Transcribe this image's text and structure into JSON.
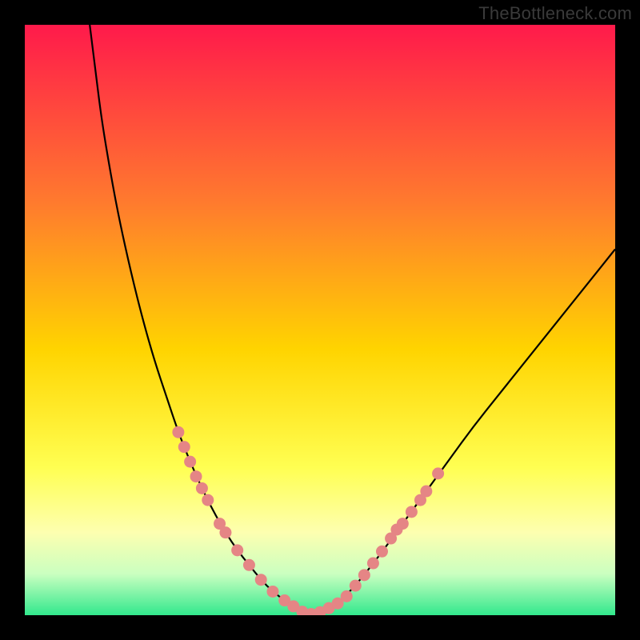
{
  "watermark": "TheBottleneck.com",
  "colors": {
    "grad_top": "#ff1a4b",
    "grad_mid1": "#ff7a2e",
    "grad_mid2": "#ffd400",
    "grad_mid3": "#ffff52",
    "grad_mid4": "#fdffb0",
    "grad_bottom1": "#caffc0",
    "grad_bottom2": "#32e88d",
    "curve": "#000000",
    "dots": "#e58585",
    "frame": "#000000"
  },
  "chart_data": {
    "type": "line",
    "title": "",
    "xlabel": "",
    "ylabel": "",
    "xlim": [
      0,
      100
    ],
    "ylim": [
      0,
      100
    ],
    "background_gradient_stops": [
      {
        "offset": 0.0,
        "color": "#ff1a4b"
      },
      {
        "offset": 0.3,
        "color": "#ff7a2e"
      },
      {
        "offset": 0.55,
        "color": "#ffd400"
      },
      {
        "offset": 0.75,
        "color": "#ffff52"
      },
      {
        "offset": 0.86,
        "color": "#fdffb0"
      },
      {
        "offset": 0.93,
        "color": "#caffc0"
      },
      {
        "offset": 1.0,
        "color": "#32e88d"
      }
    ],
    "series": [
      {
        "name": "bottleneck-curve",
        "x": [
          11.0,
          12.0,
          13.0,
          14.5,
          16.0,
          18.0,
          20.0,
          22.0,
          24.0,
          26.0,
          28.0,
          30.0,
          32.0,
          34.0,
          36.0,
          38.0,
          40.0,
          42.0,
          44.0,
          46.0,
          48.0,
          50.0,
          53.0,
          56.0,
          60.0,
          64.0,
          68.0,
          72.0,
          76.0,
          80.0,
          84.0,
          88.0,
          92.0,
          96.0,
          100.0
        ],
        "y": [
          100.0,
          92.0,
          84.0,
          75.0,
          67.0,
          58.0,
          50.0,
          43.0,
          37.0,
          31.0,
          26.0,
          21.5,
          17.5,
          14.0,
          11.0,
          8.5,
          6.0,
          4.0,
          2.5,
          1.2,
          0.2,
          0.5,
          2.0,
          5.0,
          10.0,
          15.5,
          21.0,
          26.5,
          32.0,
          37.0,
          42.0,
          47.0,
          52.0,
          57.0,
          62.0
        ]
      }
    ],
    "dot_overlay": {
      "name": "highlight-dots",
      "points": [
        {
          "x": 26.0,
          "y": 31.0
        },
        {
          "x": 27.0,
          "y": 28.5
        },
        {
          "x": 28.0,
          "y": 26.0
        },
        {
          "x": 29.0,
          "y": 23.5
        },
        {
          "x": 30.0,
          "y": 21.5
        },
        {
          "x": 31.0,
          "y": 19.5
        },
        {
          "x": 33.0,
          "y": 15.5
        },
        {
          "x": 34.0,
          "y": 14.0
        },
        {
          "x": 36.0,
          "y": 11.0
        },
        {
          "x": 38.0,
          "y": 8.5
        },
        {
          "x": 40.0,
          "y": 6.0
        },
        {
          "x": 42.0,
          "y": 4.0
        },
        {
          "x": 44.0,
          "y": 2.5
        },
        {
          "x": 45.5,
          "y": 1.5
        },
        {
          "x": 47.0,
          "y": 0.6
        },
        {
          "x": 48.5,
          "y": 0.2
        },
        {
          "x": 50.0,
          "y": 0.5
        },
        {
          "x": 51.5,
          "y": 1.2
        },
        {
          "x": 53.0,
          "y": 2.0
        },
        {
          "x": 54.5,
          "y": 3.2
        },
        {
          "x": 56.0,
          "y": 5.0
        },
        {
          "x": 57.5,
          "y": 6.8
        },
        {
          "x": 59.0,
          "y": 8.8
        },
        {
          "x": 60.5,
          "y": 10.8
        },
        {
          "x": 62.0,
          "y": 13.0
        },
        {
          "x": 63.0,
          "y": 14.5
        },
        {
          "x": 64.0,
          "y": 15.5
        },
        {
          "x": 65.5,
          "y": 17.5
        },
        {
          "x": 67.0,
          "y": 19.5
        },
        {
          "x": 68.0,
          "y": 21.0
        },
        {
          "x": 70.0,
          "y": 24.0
        }
      ]
    }
  }
}
